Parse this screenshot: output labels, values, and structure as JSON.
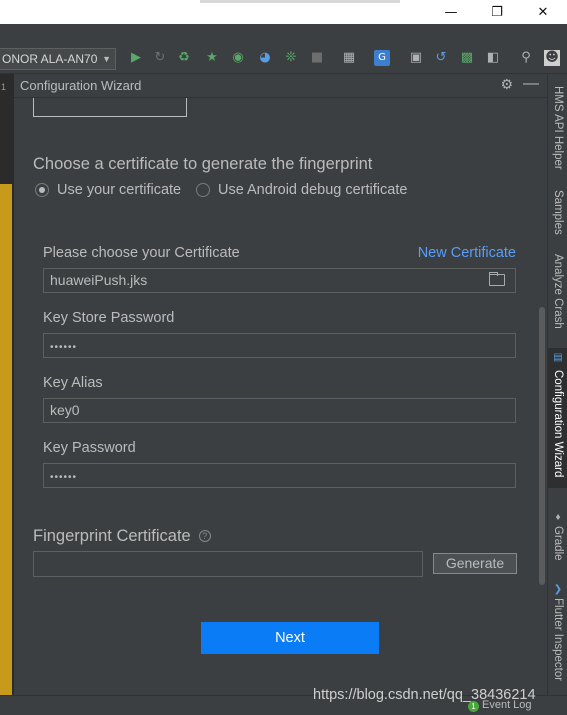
{
  "window": {
    "minimize_icon": "minimize-icon",
    "restore_icon": "restore-icon",
    "close_icon": "close-icon"
  },
  "toolbar": {
    "device": "ONOR ALA-AN70",
    "icons": [
      "run-icon",
      "rerun-icon",
      "debug-icon",
      "attach-debugger-icon",
      "profile-icon",
      "apply-changes-icon",
      "stop-icon",
      "project-structure-icon",
      "translate-icon",
      "avd-manager-icon",
      "sync-icon",
      "sdk-manager-icon",
      "layout-inspector-icon",
      "search-icon",
      "user-icon"
    ]
  },
  "left_tab": {
    "number": "1"
  },
  "tool_window": {
    "title": "Configuration Wizard"
  },
  "wizard": {
    "section_title": "Choose a certificate to generate the fingerprint",
    "radio_use_own": "Use your certificate",
    "radio_use_debug": "Use Android debug certificate",
    "certificate_label": "Please choose your Certificate",
    "new_certificate_link": "New Certificate",
    "certificate_value": "huaweiPush.jks",
    "keystore_password_label": "Key Store Password",
    "keystore_password_value": "••••••",
    "key_alias_label": "Key Alias",
    "key_alias_value": "key0",
    "key_password_label": "Key Password",
    "key_password_value": "••••••",
    "fingerprint_label": "Fingerprint Certificate",
    "fingerprint_value": "",
    "generate_button": "Generate",
    "next_button": "Next"
  },
  "right_tabs": [
    "HMS API Helper",
    "Samples",
    "Analyze Crash",
    "Configuration Wizard",
    "Gradle",
    "Flutter Inspector"
  ],
  "status": {
    "watermark": "https://blog.csdn.net/qq_38436214",
    "event_log": "Event Log",
    "event_badge": "1"
  },
  "colors": {
    "link": "#589df6",
    "primary_button": "#0a7cf5",
    "background": "#3c3f41"
  }
}
